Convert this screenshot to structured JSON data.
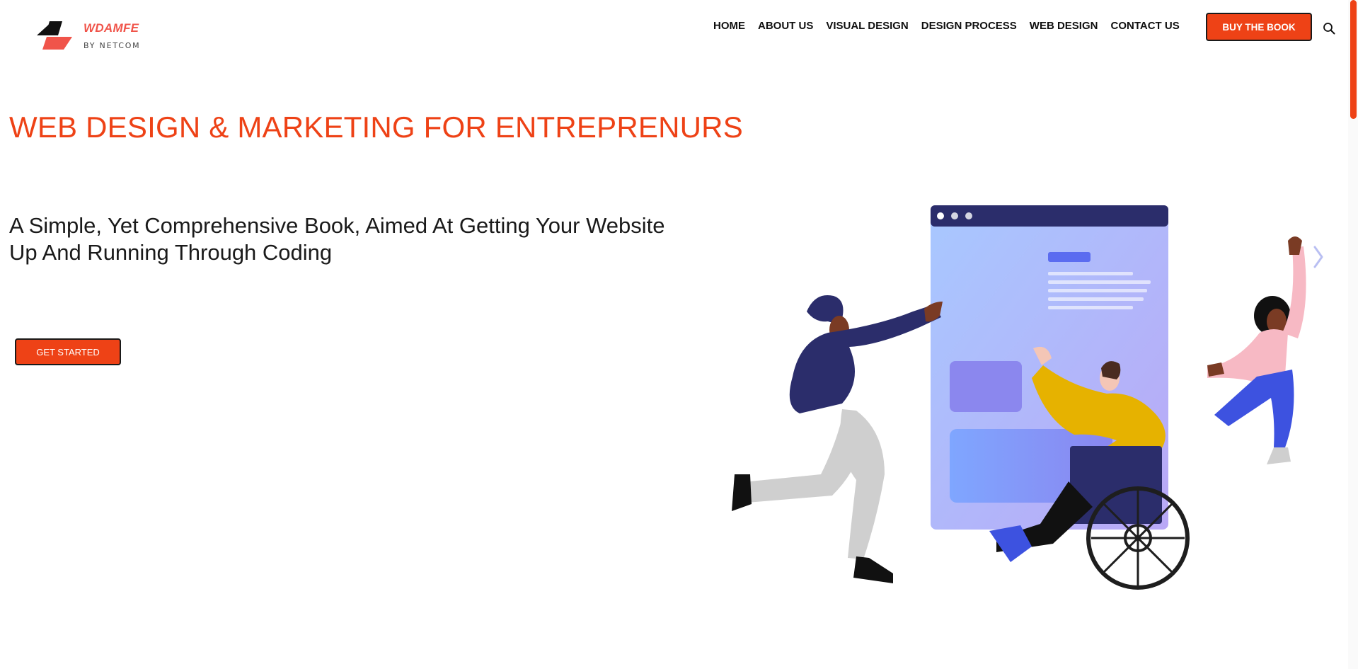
{
  "brand": {
    "name": "WDAMFE",
    "tagline": "BY NETCOM"
  },
  "nav": {
    "items": [
      "HOME",
      "ABOUT US",
      "VISUAL DESIGN",
      "DESIGN PROCESS",
      "WEB DESIGN",
      "CONTACT US"
    ],
    "cta_label": "BUY THE BOOK",
    "search_icon": "search-icon"
  },
  "hero": {
    "title": "WEB DESIGN & MARKETING FOR ENTREPRENURS",
    "subtitle_line1": "A Simple, Yet Comprehensive Book, Aimed At Getting Your Website",
    "subtitle_line2": "Up And Running Through Coding",
    "button_label": "GET STARTED"
  },
  "colors": {
    "accent": "#ee4216",
    "logo_red": "#f0544a",
    "text": "#1a1a1a"
  },
  "icons": {
    "slider_next": "chevron-right-icon"
  }
}
